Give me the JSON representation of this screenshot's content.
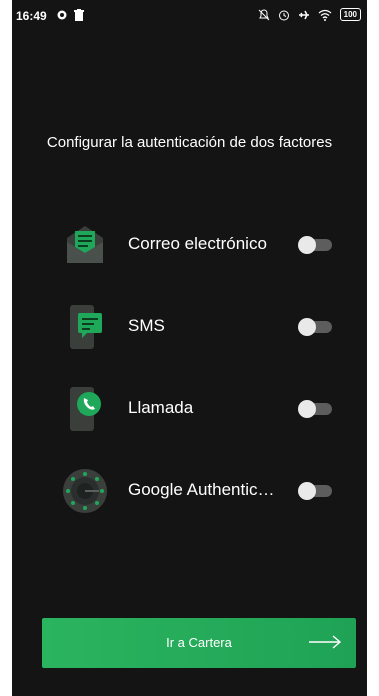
{
  "status_bar": {
    "time": "16:49",
    "battery": "100"
  },
  "title": "Configurar la autenticación de dos factores",
  "options": [
    {
      "label": "Correo electrónico",
      "icon": "email-icon",
      "enabled": false
    },
    {
      "label": "SMS",
      "icon": "sms-icon",
      "enabled": false
    },
    {
      "label": "Llamada",
      "icon": "phone-call-icon",
      "enabled": false
    },
    {
      "label": "Google Authentic…",
      "icon": "google-authenticator-icon",
      "enabled": false
    }
  ],
  "cta": {
    "label": "Ir a Cartera",
    "icon": "arrow-right-icon"
  },
  "colors": {
    "background": "#141414",
    "accent": "#22a85a",
    "toggle_knob": "#e9e9e9",
    "toggle_track": "#5d5d5d"
  }
}
